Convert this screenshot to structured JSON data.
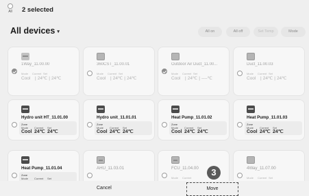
{
  "header": {
    "select_all_label": "All",
    "selected_count": "2 selected"
  },
  "title": {
    "text": "All devices",
    "caret": "▾"
  },
  "actions": {
    "all_on": "All on",
    "all_off": "All off",
    "set_temp": "Set Temp",
    "mode": "Mode"
  },
  "labels": {
    "mode": "Mode",
    "current": "Current",
    "set": "Set",
    "zone": "Zone"
  },
  "devices": [
    {
      "name": "1Way_11.00.00",
      "selected": true,
      "mode": "Cool",
      "current": "24℃",
      "set": "24℃"
    },
    {
      "name": "360CST_11.00.01",
      "selected": false,
      "mode": "Cool",
      "current": "24℃",
      "set": "24℃"
    },
    {
      "name": "Outdoor Air Duct_11.00...",
      "selected": true,
      "mode": "Cool",
      "current": "24℃",
      "set": "----℃"
    },
    {
      "name": "Duct_11.00.03",
      "selected": false,
      "mode": "Cool",
      "current": "24℃",
      "set": "24℃"
    },
    {
      "name": "Hydro unit HT_11.01.00",
      "selected": false,
      "mode": "Cool",
      "current": "24℃",
      "set": "24℃"
    },
    {
      "name": "Hydro unit_11.01.01",
      "selected": false,
      "mode": "Cool",
      "current": "24℃",
      "set": "24℃"
    },
    {
      "name": "Heat Pump_11.01.02",
      "selected": false,
      "mode": "Cool",
      "current": "24℃",
      "set": "24℃"
    },
    {
      "name": "Heat Pump_11.01.03",
      "selected": false,
      "mode": "Cool",
      "current": "24℃",
      "set": "24℃"
    },
    {
      "name": "Heat Pump_11.01.04",
      "selected": false
    },
    {
      "name": "AHU_11.03.01",
      "selected": false
    },
    {
      "name": "FCU_11.04.00",
      "selected": false
    },
    {
      "name": "4Way_11.07.00",
      "selected": false
    }
  ],
  "footer": {
    "cancel": "Cancel",
    "move": "Move"
  },
  "step_badge": "3"
}
